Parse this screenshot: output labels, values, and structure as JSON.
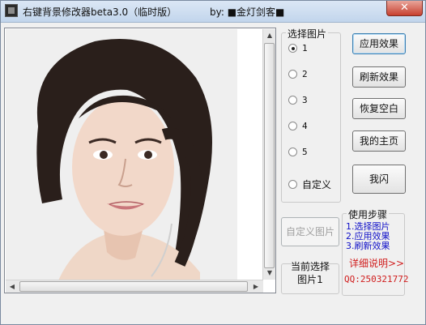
{
  "window": {
    "title": "右键背景修改器beta3.0（临时版）",
    "author": "by: ■金灯剑客■",
    "close_glyph": "✕"
  },
  "image_panel": {
    "scroll_up": "▲",
    "scroll_down": "▼",
    "scroll_left": "◀",
    "scroll_right": "▶"
  },
  "select_group": {
    "title": "选择图片",
    "options": [
      "1",
      "2",
      "3",
      "4",
      "5",
      "自定义"
    ],
    "selected": "1"
  },
  "buttons": {
    "apply": "应用效果",
    "refresh": "刷新效果",
    "restore": "恢复空白",
    "homepage": "我的主页",
    "flash": "我闪",
    "custom_image": "自定义图片"
  },
  "current_selection": {
    "line1": "当前选择",
    "line2": "图片1"
  },
  "steps_group": {
    "title": "使用步骤",
    "steps": [
      "1.选择图片",
      "2.应用效果",
      "3.刷新效果"
    ],
    "detail_link": "详细说明>>",
    "qq": "QQ:250321772"
  }
}
